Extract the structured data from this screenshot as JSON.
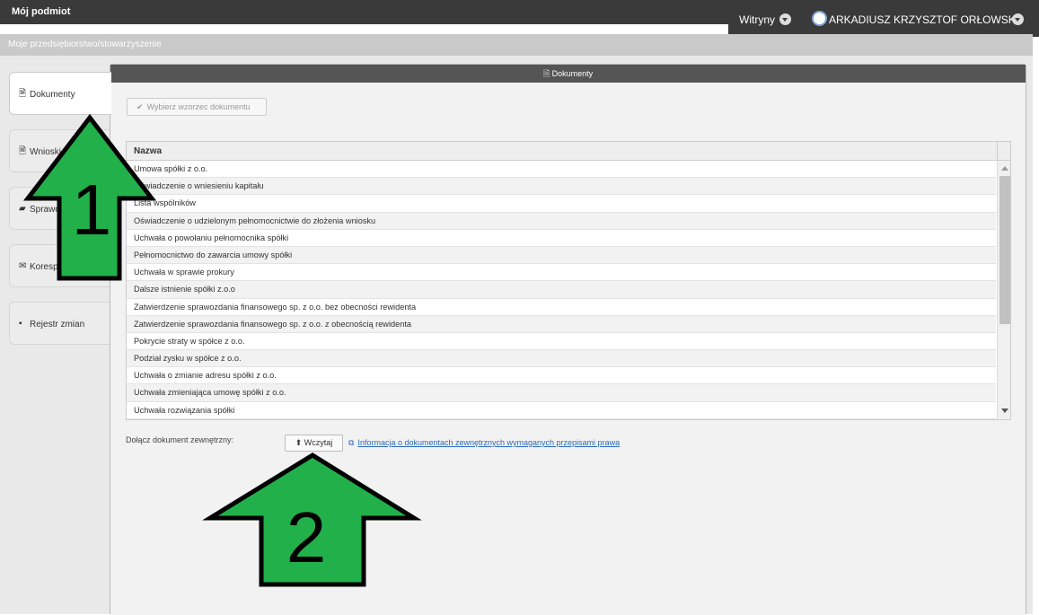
{
  "header": {
    "app_title": "Mój podmiot",
    "sites_label": "Witryny",
    "user_name": "ARKADIUSZ KRZYSZTOF ORŁOWSKI"
  },
  "subheader": {
    "title": "Moje przedsiębiorstwo/stowarzyszenie"
  },
  "sidebar": {
    "tabs": [
      {
        "label": "Dokumenty",
        "icon": "document-icon"
      },
      {
        "label": "Wnioski",
        "icon": "upload-document-icon"
      },
      {
        "label": "Sprawo",
        "icon": "folder-icon"
      },
      {
        "label": "Koresp",
        "icon": "envelope-icon"
      },
      {
        "label": "Rejestr zmian",
        "icon": "briefcase-icon"
      }
    ]
  },
  "panel": {
    "title": "Dokumenty",
    "choose_template_label": "Wybierz wzorzec dokumentu",
    "table": {
      "column_header": "Nazwa",
      "rows": [
        "Umowa spółki z o.o.",
        "Oświadczenie o wniesieniu kapitału",
        "Lista wspólników",
        "Oświadczenie o udzielonym pełnomocnictwie do złożenia wniosku",
        "Uchwała o powołaniu pełnomocnika spółki",
        "Pełnomocnictwo do zawarcia umowy spółki",
        "Uchwała w sprawie prokury",
        "Dalsze istnienie spółki z.o.o",
        "Zatwierdzenie sprawozdania finansowego sp. z o.o. bez obecności rewidenta",
        "Zatwierdzenie sprawozdania finansowego sp. z o.o. z obecnością rewidenta",
        "Pokrycie straty w spółce z o.o.",
        "Podział zysku w spółce z o.o.",
        "Uchwała o zmianie adresu spółki z o.o.",
        "Uchwała zmieniająca umowę spółki z o.o.",
        "Uchwała rozwiązania spółki"
      ]
    },
    "attach_label": "Dołącz dokument zewnętrzny:",
    "upload_label": "Wczytaj",
    "info_link": "Informacja o dokumentach zewnętrznych wymaganych przepisami prawa"
  },
  "annotations": {
    "arrow_1_label": "1",
    "arrow_2_label": "2",
    "arrow_color": "#22b04b"
  }
}
